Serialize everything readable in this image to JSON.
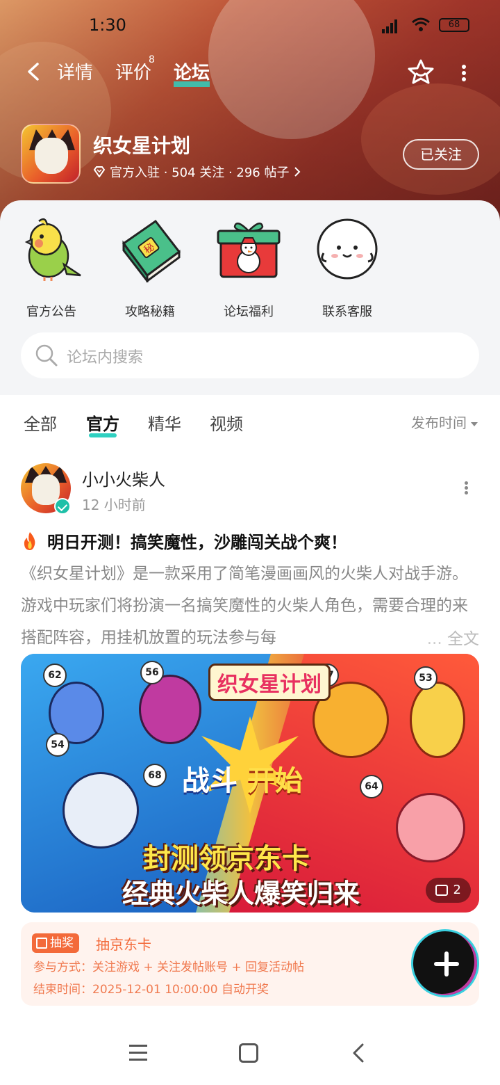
{
  "status": {
    "time": "1:30",
    "battery": "68"
  },
  "nav": {
    "tabs": [
      {
        "label": "详情"
      },
      {
        "label": "评价",
        "badge": "8"
      },
      {
        "label": "论坛"
      }
    ]
  },
  "game": {
    "title": "织女星计划",
    "meta": "官方入驻 · 504 关注 · 296 帖子",
    "follow_label": "已关注"
  },
  "quick": [
    {
      "label": "官方公告",
      "icon": "bird-icon"
    },
    {
      "label": "攻略秘籍",
      "icon": "book-icon"
    },
    {
      "label": "论坛福利",
      "icon": "gift-icon"
    },
    {
      "label": "联系客服",
      "icon": "mascot-icon"
    }
  ],
  "search": {
    "placeholder": "论坛内搜索"
  },
  "filter": {
    "tabs": [
      "全部",
      "官方",
      "精华",
      "视频"
    ],
    "sort": "发布时间"
  },
  "post": {
    "author": "小小火柴人",
    "time": "12 小时前",
    "title": "明日开测！搞笑魔性，沙雕闯关战个爽！",
    "body": "《织女星计划》是一款采用了简笔漫画画风的火柴人对战手游。游戏中玩家们将扮演一名搞笑魔性的火柴人角色，需要合理的来搭配阵容，用挂机放置的玩法参与每",
    "ellipsis": "...",
    "read_more": "全文",
    "banner": {
      "logo": "织女星计划",
      "fight_1": "战斗",
      "fight_2": "开始",
      "caption_1": "封测领京东卡",
      "caption_2": "经典火柴人爆笑归来",
      "levels": [
        "62",
        "56",
        "47",
        "53",
        "54",
        "68",
        "64"
      ],
      "image_count": "2"
    },
    "lottery": {
      "tag": "抽奖",
      "title": "抽京东卡",
      "line1": "参与方式：关注游戏 + 关注发帖账号 + 回复活动帖",
      "line2": "结束时间：2025-12-01 10:00:00 自动开奖"
    }
  },
  "colors": {
    "accent": "#2fd0c0",
    "lottery": "#f36a3a",
    "fab": "#111111"
  }
}
